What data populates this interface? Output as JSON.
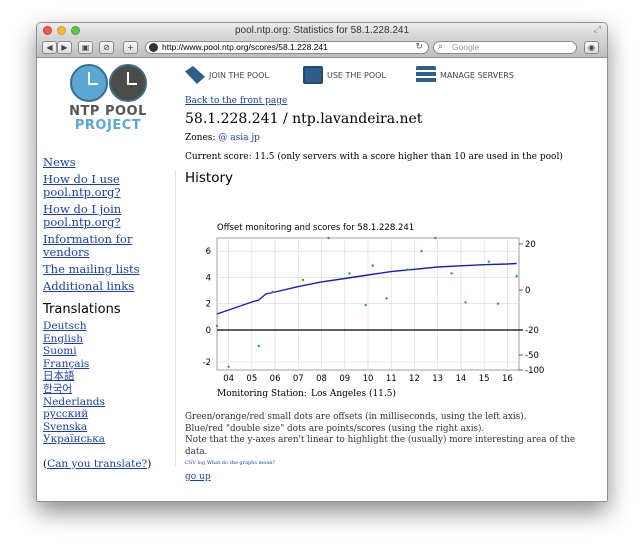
{
  "window": {
    "title": "pool.ntp.org: Statistics for 58.1.228.241"
  },
  "toolbar": {
    "url": "http://www.pool.ntp.org/scores/58.1.228.241",
    "search_placeholder": "Google",
    "back": "◀",
    "forward": "▶",
    "add": "+"
  },
  "logo": {
    "line1": "NTP POOL",
    "line2": "PROJECT"
  },
  "nav": {
    "join": "JOIN THE POOL",
    "use": "USE THE POOL",
    "manage": "MANAGE SERVERS"
  },
  "sidebar": {
    "links": [
      "News",
      "How do I use pool.ntp.org?",
      "How do I join pool.ntp.org?",
      "Information for vendors",
      "The mailing lists",
      "Additional links"
    ],
    "translations_heading": "Translations",
    "languages": [
      "Deutsch",
      "English",
      "Suomi",
      "Français",
      "日本語",
      "한국어",
      "Nederlands",
      "русский",
      "Svenska",
      "Українська"
    ],
    "translate_prefix": "(",
    "translate_link": "Can you translate?",
    "translate_suffix": ")"
  },
  "main": {
    "back_link": "Back to the front page",
    "heading": "58.1.228.241 / ntp.lavandeira.net",
    "zones_label": "Zones:",
    "zones": [
      "@",
      "asia",
      "jp"
    ],
    "current_score": "Current score: 11.5 (only servers with a score higher than 10 are used in the pool)",
    "history_heading": "History",
    "notes": [
      "Green/orange/red small dots are offsets (in milliseconds, using the left axis).",
      "Blue/red \"double size\" dots are points/scores (using the right axis).",
      "Note that the y-axes aren't linear to highlight the (usually) more interesting area of the data."
    ],
    "tiny_links": "CSV log  What do the graphs mean?",
    "go_up": "go up"
  },
  "chart_data": {
    "type": "line",
    "title": "Offset monitoring and scores for 58.1.228.241",
    "x_ticks": [
      "04",
      "05",
      "06",
      "07",
      "08",
      "09",
      "10",
      "11",
      "12",
      "13",
      "14",
      "15",
      "16"
    ],
    "y_left_ticks": [
      "6",
      "4",
      "2",
      "0",
      "-2"
    ],
    "y_right_ticks": [
      "20",
      "0",
      "-20",
      "-50",
      "-100"
    ],
    "station_label": "Monitoring Station:",
    "station": "Los Angeles (11.5)",
    "series": [
      {
        "name": "score",
        "color": "#1a1ac8",
        "x": [
          3.5,
          5.0,
          5.3,
          5.6,
          6.0,
          7.0,
          8.0,
          9.0,
          10.0,
          11.0,
          12.0,
          13.0,
          14.0,
          15.0,
          16.0,
          16.4
        ],
        "y": [
          -12,
          -6,
          -5,
          -2,
          -1,
          1.5,
          3.5,
          5,
          6.5,
          8,
          9,
          10,
          10.5,
          11,
          11.3,
          11.5
        ]
      },
      {
        "name": "offset",
        "color": "#2aa62a",
        "x": [
          3.5,
          4.0,
          5.3,
          5.9,
          7.2,
          8.3,
          9.2,
          9.9,
          10.2,
          10.8,
          11.7,
          12.3,
          12.9,
          13.6,
          14.2,
          15.2,
          15.6,
          16.4
        ],
        "y": [
          0.3,
          -2.3,
          -1.0,
          2.9,
          3.8,
          7.0,
          4.3,
          1.9,
          4.9,
          2.4,
          4.6,
          6.0,
          7.3,
          4.3,
          2.1,
          5.2,
          2.0,
          4.1
        ]
      }
    ],
    "grid": true,
    "zero_line": true
  }
}
